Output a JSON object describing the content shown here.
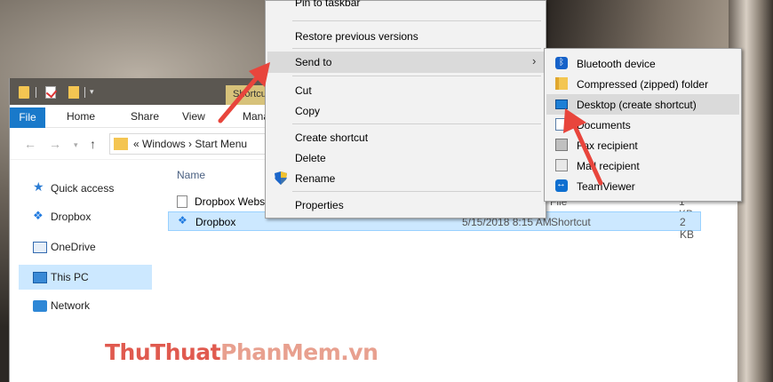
{
  "explorer": {
    "contextual_tab": "Shortcut Tools",
    "ribbon": {
      "file": "File",
      "home": "Home",
      "share": "Share",
      "view": "View",
      "manage": "Manage"
    },
    "address_path": "« Windows › Start Menu",
    "nav_pane": [
      "Quick access",
      "Dropbox",
      "OneDrive",
      "This PC",
      "Network"
    ],
    "column_name": "Name",
    "files": [
      {
        "name": "Dropbox Website",
        "date": "",
        "type": "File",
        "size": "1 KB"
      },
      {
        "name": "Dropbox",
        "date": "5/15/2018 8:15 AM",
        "type": "Shortcut",
        "size": "2 KB"
      }
    ]
  },
  "context_menu": {
    "items": [
      "Pin to taskbar",
      "Restore previous versions",
      "Send to",
      "Cut",
      "Copy",
      "Create shortcut",
      "Delete",
      "Rename",
      "Properties"
    ],
    "highlighted": "Send to"
  },
  "send_to_submenu": {
    "items": [
      "Bluetooth device",
      "Compressed (zipped) folder",
      "Desktop (create shortcut)",
      "Documents",
      "Fax recipient",
      "Mail recipient",
      "TeamViewer"
    ],
    "highlighted": "Desktop (create shortcut)"
  },
  "watermark": {
    "part1": "ThuThuat",
    "part2": "PhanMem.vn"
  },
  "colors": {
    "accent": "#1979ca",
    "selection": "#cce8ff",
    "annotation_arrow": "#e8453c"
  }
}
